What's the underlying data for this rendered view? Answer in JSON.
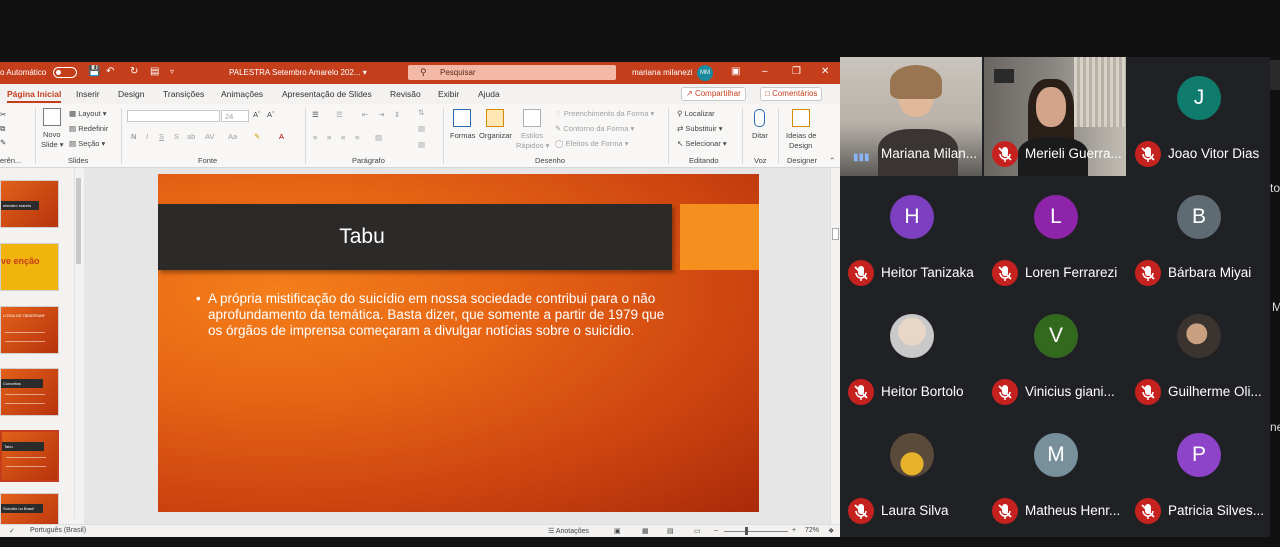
{
  "powerpoint": {
    "autosave_label": "o Automático",
    "document_title": "PALESTRA Setembro Amarelo 202... ▾",
    "search_placeholder": "Pesquisar",
    "user_name": "mariana milanezi",
    "user_initials": "MM",
    "tabs": [
      "Página Inicial",
      "Inserir",
      "Design",
      "Transições",
      "Animações",
      "Apresentação de Slides",
      "Revisão",
      "Exibir",
      "Ajuda"
    ],
    "share_label": "Compartilhar",
    "comments_label": "Comentários",
    "ribbon": {
      "layout": "Layout ▾",
      "reset": "Redefinir",
      "section": "Seção ▾",
      "new_slide": "Novo",
      "new_slide_2": "Slide ▾",
      "font_size": "24",
      "shapes": "Formas",
      "arrange": "Organizar",
      "quick_styles": "Estilos",
      "quick_styles_2": "Rápidos ▾",
      "fill": "Preenchimento da Forma ▾",
      "outline": "Contorno da Forma ▾",
      "effects": "Efeitos de Forma ▾",
      "find": "Localizar",
      "replace": "Substituir ▾",
      "select": "Selecionar ▾",
      "dictate": "Ditar",
      "designer": "Ideias de",
      "designer_2": "Design",
      "groups": [
        "erên...",
        "Slides",
        "Fonte",
        "Parágrafo",
        "Desenho",
        "Editando",
        "Voz",
        "Designer"
      ]
    },
    "thumb_labels": [
      "etembro  marelo",
      "ve  enção",
      "LOGIA DE OBSERVAR",
      "Conceitos",
      "Tabu",
      "Suicídio no Brasil"
    ],
    "slide": {
      "title": "Tabu",
      "bullet_dot": "•",
      "bullet_text": "A própria mistificação do suicídio em nossa sociedade contribui para o não aprofundamento da temática. Basta dizer, que somente a partir de 1979 que os órgãos de imprensa começaram a divulgar notícias sobre o suicídio."
    },
    "status": {
      "language": "Português (Brasil)",
      "notes": "Anotações",
      "zoom": "72%"
    }
  },
  "meet": {
    "participants": [
      {
        "name": "Mariana Milan...",
        "type": "video",
        "muted": false
      },
      {
        "name": "Merieli Guerra...",
        "type": "video",
        "muted": true
      },
      {
        "name": "Joao Vitor Dias",
        "initial": "J",
        "color": "#0f7b6c",
        "muted": true
      },
      {
        "name": "Heitor Tanizaka",
        "initial": "H",
        "color": "#7b3fbf",
        "muted": true
      },
      {
        "name": "Loren Ferrarezi",
        "initial": "L",
        "color": "#8e24aa",
        "muted": true
      },
      {
        "name": "Bárbara Miyai",
        "initial": "B",
        "color": "#5f6b73",
        "muted": true
      },
      {
        "name": "Heitor Bortolo",
        "type": "photo",
        "muted": true
      },
      {
        "name": "Vinicius giani...",
        "initial": "V",
        "color": "#33691e",
        "muted": true
      },
      {
        "name": "Guilherme Oli...",
        "type": "photo",
        "muted": true
      },
      {
        "name": "Laura Silva",
        "type": "photo",
        "muted": true
      },
      {
        "name": "Matheus Henr...",
        "initial": "M",
        "color": "#78909c",
        "muted": true
      },
      {
        "name": "Patricia Silves...",
        "initial": "P",
        "color": "#8e44c8",
        "muted": true
      }
    ]
  },
  "edge_fragments": [
    "to",
    "M",
    "ne"
  ]
}
